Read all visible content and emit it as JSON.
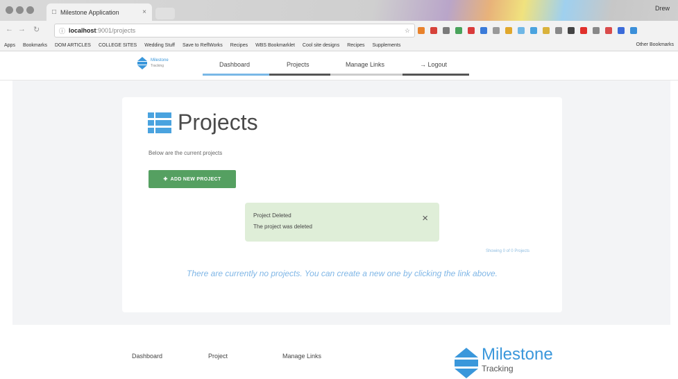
{
  "browser": {
    "tab_title": "Milestone Application",
    "tab_icon": "page-icon",
    "profile_name": "Drew",
    "url_host": "localhost",
    "url_path": ":9001/projects",
    "bookmarks": [
      "Apps",
      "Bookmarks",
      "DOM ARTICLES",
      "COLLEGE SITES",
      "Wedding Stuff",
      "Save to ReflWorks",
      "Recipes",
      "WBS Bookmarklet",
      "Cool site designs",
      "Recipes",
      "Supplements"
    ],
    "other_bookmarks": "Other Bookmarks",
    "extension_colors": [
      "#e8822c",
      "#d6423a",
      "#7a7a7a",
      "#49a35b",
      "#d93b3b",
      "#3b7bd9",
      "#999999",
      "#e0a72c",
      "#6fb7e6",
      "#4aa3df",
      "#d9b23b",
      "#888888",
      "#444444",
      "#e0302b",
      "#888888",
      "#d94b4b",
      "#3b6bd9",
      "#3b8fd9"
    ]
  },
  "nav": {
    "brand_line1": "Milestone",
    "brand_line2": "Tracking",
    "links": [
      "Dashboard",
      "Projects",
      "Manage Links"
    ],
    "logout": "Logout",
    "underline_colors": [
      "#79b8e6",
      "#555555",
      "#cccccc",
      "#555555"
    ]
  },
  "main": {
    "title": "Projects",
    "subtitle": "Below are the current projects",
    "add_button": "ADD NEW PROJECT",
    "alert_title": "Project Deleted",
    "alert_message": "The project was deleted",
    "alert_close": "×",
    "showing": "Showing 0 of 0 Projects",
    "empty_message": "There are currently no projects. You can create a new one by clicking the link above."
  },
  "footer": {
    "links": [
      "Dashboard",
      "Project",
      "Manage Links"
    ],
    "logo_line1": "Milestone",
    "logo_line2": "Tracking"
  },
  "colors": {
    "accent": "#3a97db",
    "success": "#55a061",
    "alert_bg": "#dfeed8"
  }
}
